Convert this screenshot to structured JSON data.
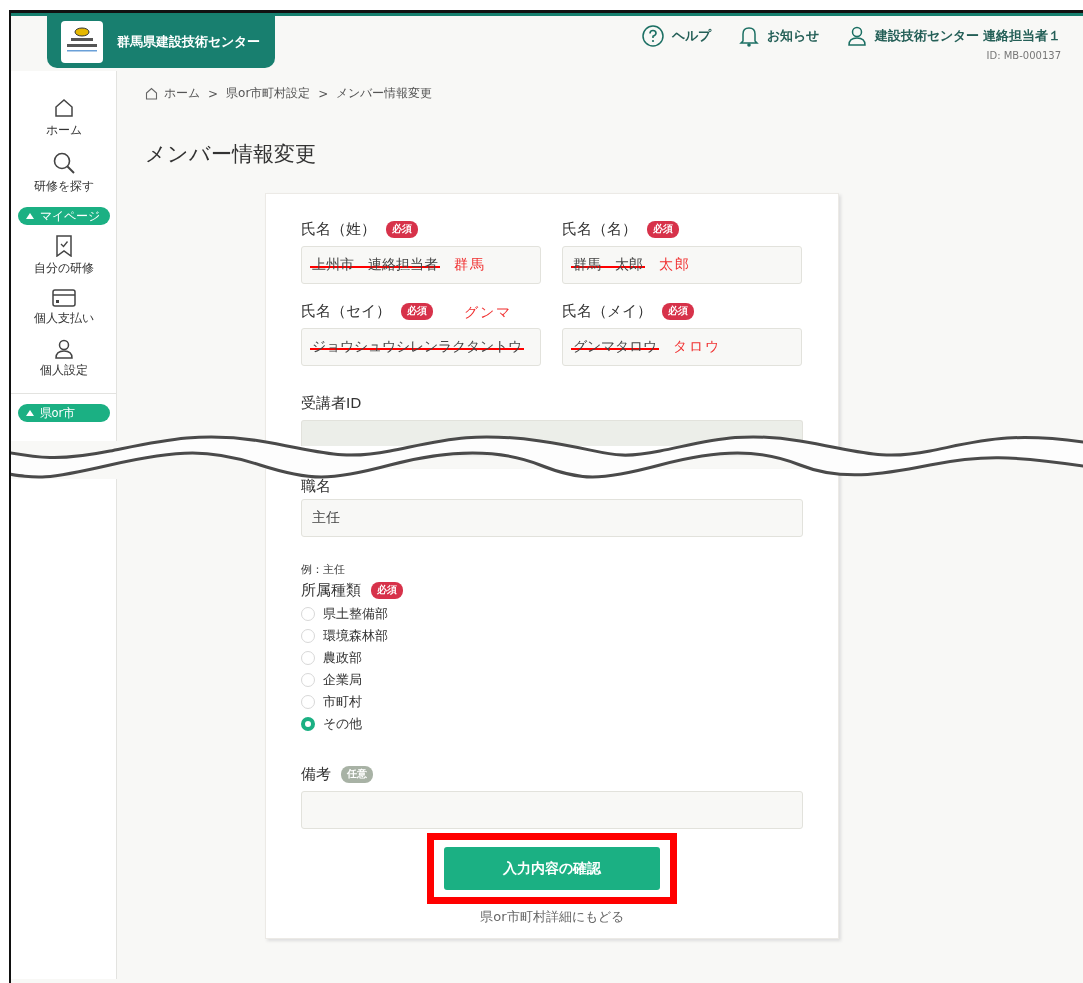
{
  "header": {
    "site_title": "群馬県建設技術センター",
    "links": [
      {
        "kind": "help",
        "label": "ヘルプ"
      },
      {
        "kind": "notice",
        "label": "お知らせ"
      }
    ],
    "user": {
      "name": "建設技術センター 連絡担当者１",
      "id": "ID: MB-000137"
    }
  },
  "sidebar": {
    "items": [
      {
        "kind": "home",
        "label": "ホーム"
      },
      {
        "kind": "search",
        "label": "研修を探す"
      },
      {
        "kind": "section",
        "label": "マイページ",
        "expanded": true
      },
      {
        "kind": "bookmark",
        "label": "自分の研修"
      },
      {
        "kind": "card",
        "label": "個人支払い"
      },
      {
        "kind": "person",
        "label": "個人設定"
      },
      {
        "kind": "section",
        "label": "県or市",
        "expanded": true
      }
    ]
  },
  "breadcrumb": {
    "separator": ">",
    "items": [
      "ホーム",
      "県or市町村設定",
      "メンバー情報変更"
    ]
  },
  "title": "メンバー情報変更",
  "form": {
    "name_fields": [
      {
        "label": "氏名（姓）",
        "badge": "必須",
        "required": true,
        "value": "上州市　連絡担当者",
        "struck": true,
        "correction": "群馬",
        "kind": "inline"
      },
      {
        "label": "氏名（名）",
        "badge": "必須",
        "required": true,
        "value": "群馬　太郎",
        "struck": true,
        "correction": "太郎",
        "kind": "inline"
      },
      {
        "label": "氏名（セイ）",
        "badge": "必須",
        "required": true,
        "value": "ジョウシュウシレンラクタントウ",
        "struck": true,
        "correction": "グンマ",
        "kind": "above"
      },
      {
        "label": "氏名（メイ）",
        "badge": "必須",
        "required": true,
        "value": "グンマタロウ",
        "struck": true,
        "correction": "タロウ",
        "kind": "inline"
      }
    ],
    "id_field": {
      "label": "受講者ID",
      "disabled": true
    },
    "job_field": {
      "label": "職名",
      "value": "主任",
      "hint": "例：主任"
    },
    "affiliation": {
      "label": "所属種類",
      "badge": "必須",
      "required": true,
      "options": [
        {
          "label": "県土整備部",
          "selected": false
        },
        {
          "label": "環境森林部",
          "selected": false
        },
        {
          "label": "農政部",
          "selected": false
        },
        {
          "label": "企業局",
          "selected": false
        },
        {
          "label": "市町村",
          "selected": false
        },
        {
          "label": "その他",
          "selected": true
        }
      ]
    },
    "remarks": {
      "label": "備考",
      "badge": "任意",
      "required": false
    },
    "submit": {
      "label": "入力内容の確認",
      "highlighted": true
    },
    "back_link": "県or市町村詳細にもどる"
  }
}
